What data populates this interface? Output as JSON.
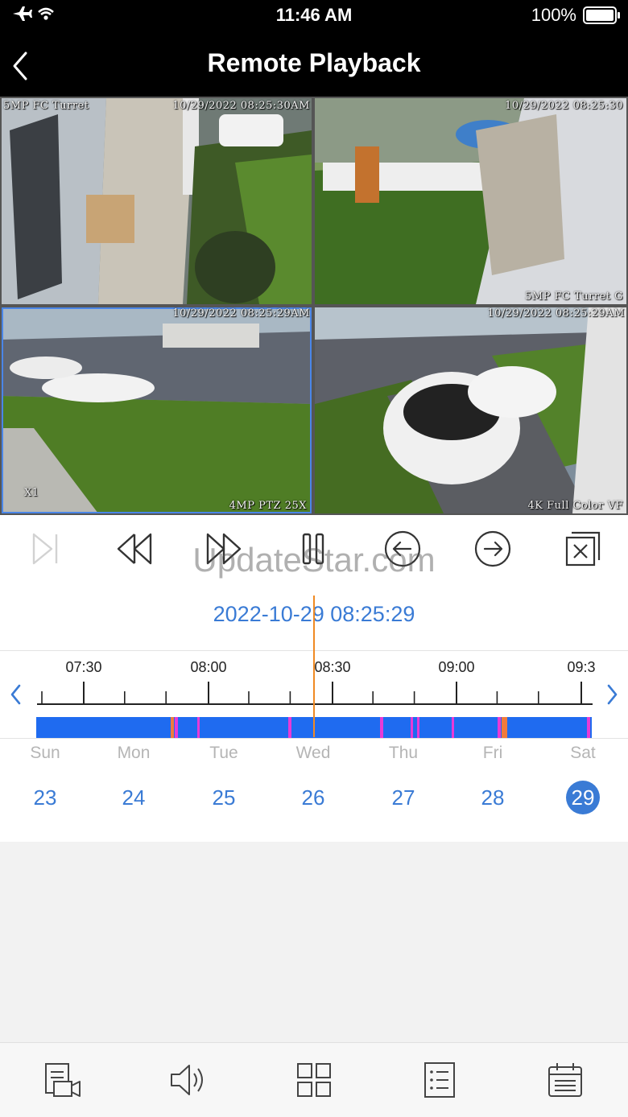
{
  "status_bar": {
    "time": "11:46 AM",
    "battery": "100%"
  },
  "header": {
    "title": "Remote Playback"
  },
  "cameras": [
    {
      "name": "5MP FC Turret",
      "timestamp": "10/29/2022 08:25:30AM",
      "label": ""
    },
    {
      "name": "5MP FC Turret G",
      "timestamp": "10/29/2022 08:25:30",
      "label": ""
    },
    {
      "name": "4MP PTZ 25X",
      "timestamp": "10/29/2022 08:25:29AM",
      "label": "X1"
    },
    {
      "name": "4K Full Color VF",
      "timestamp": "10/29/2022 08:25:29AM",
      "label": ""
    }
  ],
  "watermark": "UpdateStar.com",
  "playback": {
    "current_datetime": "2022-10-29 08:25:29"
  },
  "timeline": {
    "tick_labels": [
      "07:30",
      "08:00",
      "08:30",
      "09:00",
      "09:3"
    ],
    "colors": {
      "continuous": "#1f6bf0",
      "motion": "#f07b3c",
      "alarm": "#e83ad6",
      "cursor": "#f08a24"
    }
  },
  "week": {
    "days": [
      {
        "name": "Sun",
        "date": "23"
      },
      {
        "name": "Mon",
        "date": "24"
      },
      {
        "name": "Tue",
        "date": "25"
      },
      {
        "name": "Wed",
        "date": "26"
      },
      {
        "name": "Thu",
        "date": "27"
      },
      {
        "name": "Fri",
        "date": "28"
      },
      {
        "name": "Sat",
        "date": "29"
      }
    ],
    "selected": "29"
  },
  "icons": {
    "controls": [
      "next-frame-icon",
      "rewind-icon",
      "fast-forward-icon",
      "pause-icon",
      "step-back-icon",
      "step-forward-icon",
      "close-all-icon"
    ],
    "tabs": [
      "record-icon",
      "speaker-icon",
      "split-screen-icon",
      "list-icon",
      "calendar-icon"
    ]
  }
}
